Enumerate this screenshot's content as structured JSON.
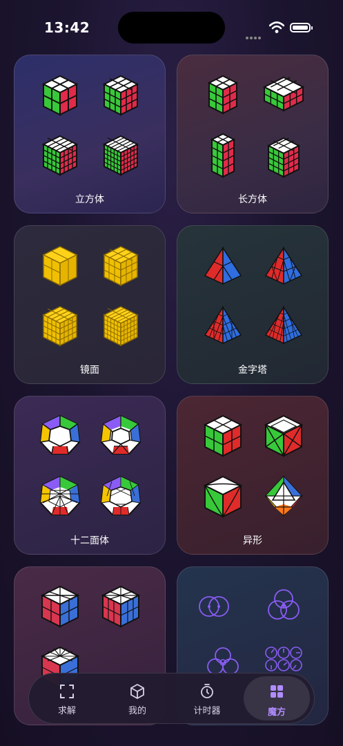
{
  "status": {
    "time": "13:42"
  },
  "categories": [
    {
      "label": "立方体"
    },
    {
      "label": "长方体"
    },
    {
      "label": "镜面"
    },
    {
      "label": "金字塔"
    },
    {
      "label": "十二面体"
    },
    {
      "label": "异形"
    },
    {
      "label": ""
    },
    {
      "label": ""
    }
  ],
  "tabbar": {
    "tabs": [
      {
        "label": "求解",
        "icon": "scan-icon"
      },
      {
        "label": "我的",
        "icon": "cube-icon"
      },
      {
        "label": "计时器",
        "icon": "stopwatch-icon"
      },
      {
        "label": "魔方",
        "icon": "grid-icon"
      }
    ],
    "active": "魔方"
  },
  "colors": {
    "accent": "#b08cff",
    "red": "#e23b3b",
    "green": "#38c93a",
    "yellow": "#f5c400",
    "blue": "#3a6fd8",
    "purple": "#8a5cf5"
  }
}
